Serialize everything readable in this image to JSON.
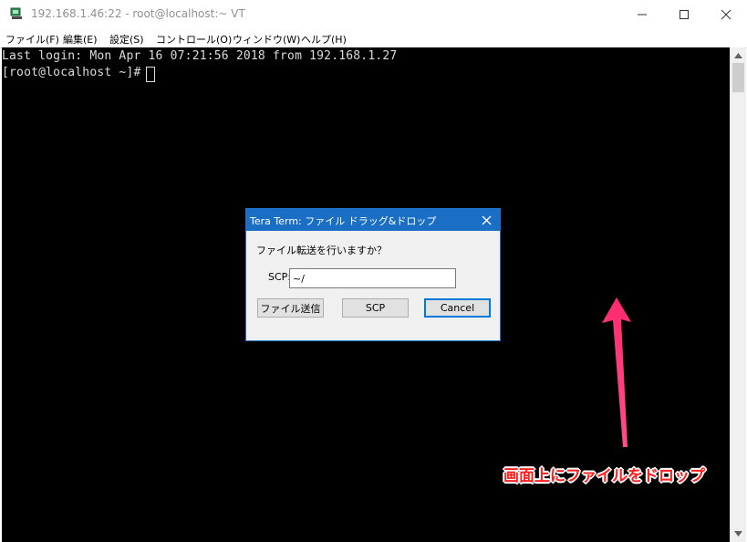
{
  "window": {
    "title": "192.168.1.46:22 - root@localhost:~ VT",
    "controls": [
      "minimize-icon",
      "maximize-icon",
      "close-icon"
    ]
  },
  "menu": {
    "items": [
      "ファイル(F)",
      "編集(E)",
      "設定(S)",
      "コントロール(O)",
      "ウィンドウ(W)",
      "ヘルプ(H)"
    ]
  },
  "terminal": {
    "lines": [
      "Last login: Mon Apr 16 07:21:56 2018 from 192.168.1.27",
      "[root@localhost ~]# "
    ]
  },
  "dialog": {
    "title": "Tera Term: ファイル ドラッグ&ドロップ",
    "prompt": "ファイル転送を行いますか？",
    "scp_label": "SCP:",
    "scp_value": "~/",
    "buttons": {
      "send": "ファイル送信",
      "scp": "SCP",
      "cancel": "Cancel"
    }
  },
  "annotation": {
    "text": "画面上にファイルをドロップ",
    "color": "#ff2a6e"
  },
  "colors": {
    "terminal_bg": "#000000",
    "terminal_fg": "#dcdcdc",
    "dialog_title_bg": "#1a6fc4"
  }
}
